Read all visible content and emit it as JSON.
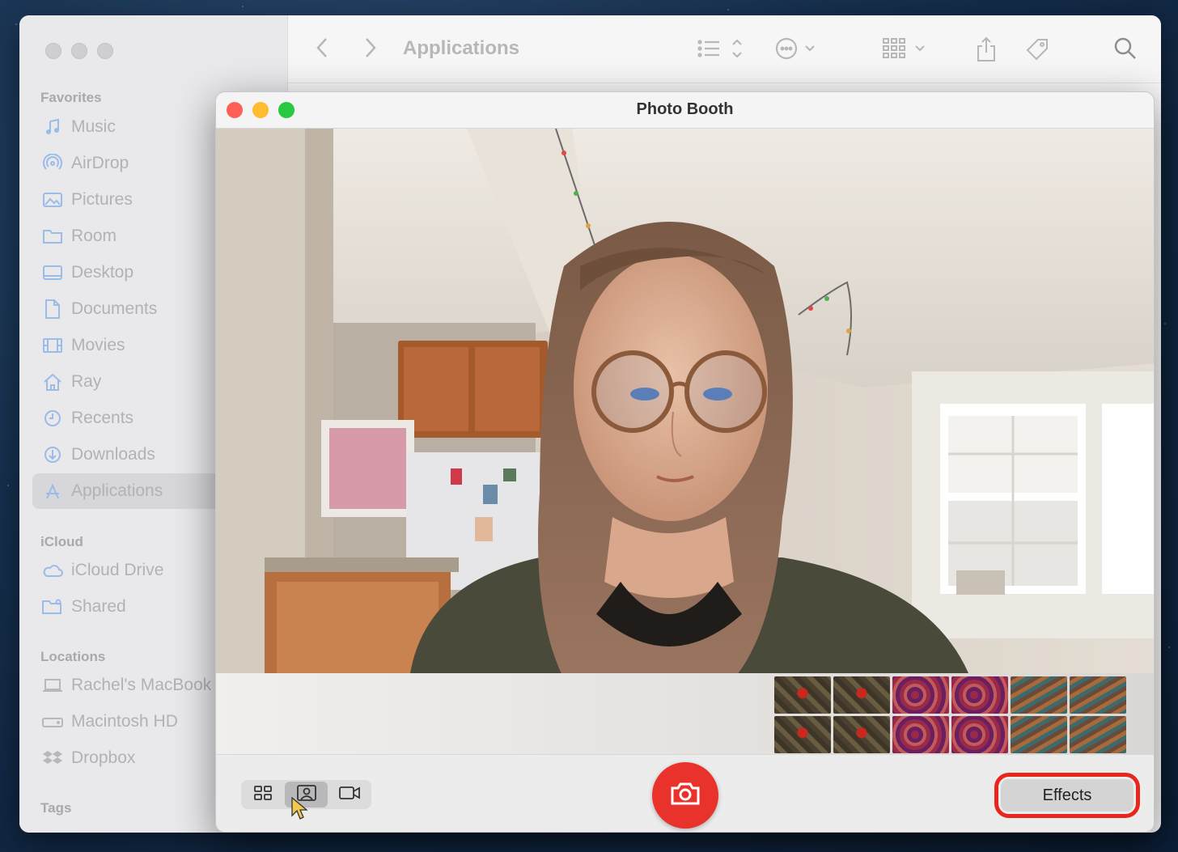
{
  "finder": {
    "toolbar": {
      "title": "Applications"
    },
    "sidebar": {
      "favorites_label": "Favorites",
      "favorites": [
        {
          "label": "Music",
          "icon": "music-icon"
        },
        {
          "label": "AirDrop",
          "icon": "airdrop-icon"
        },
        {
          "label": "Pictures",
          "icon": "pictures-icon"
        },
        {
          "label": "Room",
          "icon": "folder-icon"
        },
        {
          "label": "Desktop",
          "icon": "desktop-icon"
        },
        {
          "label": "Documents",
          "icon": "document-icon"
        },
        {
          "label": "Movies",
          "icon": "movies-icon"
        },
        {
          "label": "Ray",
          "icon": "home-icon"
        },
        {
          "label": "Recents",
          "icon": "clock-icon"
        },
        {
          "label": "Downloads",
          "icon": "download-icon"
        },
        {
          "label": "Applications",
          "icon": "applications-icon",
          "selected": true
        }
      ],
      "icloud_label": "iCloud",
      "icloud": [
        {
          "label": "iCloud Drive",
          "icon": "cloud-icon"
        },
        {
          "label": "Shared",
          "icon": "shared-folder-icon"
        }
      ],
      "locations_label": "Locations",
      "locations": [
        {
          "label": "Rachel's MacBook",
          "icon": "laptop-icon"
        },
        {
          "label": "Macintosh HD",
          "icon": "disk-icon"
        },
        {
          "label": "Dropbox",
          "icon": "dropbox-icon"
        }
      ],
      "tags_label": "Tags"
    }
  },
  "photobooth": {
    "title": "Photo Booth",
    "modes": [
      "grid-mode",
      "single-photo-mode",
      "video-mode"
    ],
    "selected_mode": "single-photo-mode",
    "effects_label": "Effects",
    "thumbnail_count": 12
  },
  "colors": {
    "close": "#fe5f57",
    "minimize": "#febc2e",
    "maximize": "#28c840",
    "shutter": "#e8322b",
    "highlight": "#e8261c",
    "accent": "#9bbbe8"
  }
}
